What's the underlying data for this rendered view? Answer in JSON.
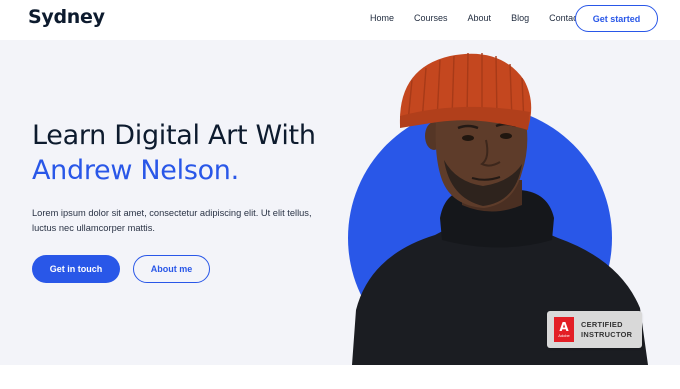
{
  "header": {
    "logo": "Sydney",
    "nav": [
      "Home",
      "Courses",
      "About",
      "Blog",
      "Contact"
    ],
    "cta_label": "Get started"
  },
  "hero": {
    "title_line1": "Learn Digital Art With",
    "title_line2": "Andrew Nelson.",
    "description": "Lorem ipsum dolor sit amet, consectetur adipiscing elit. Ut elit tellus, luctus nec ullamcorper mattis.",
    "primary_button": "Get in touch",
    "secondary_button": "About me",
    "image_subject": "man in orange beanie and black turtleneck",
    "badge": {
      "logo_letter": "A",
      "logo_word": "Adobe",
      "line1": "CERTIFIED",
      "line2": "INSTRUCTOR"
    }
  },
  "colors": {
    "accent": "#2957e8",
    "hero_bg": "#f3f4f9",
    "heading": "#0d1b2e",
    "beanie": "#c4471f"
  }
}
